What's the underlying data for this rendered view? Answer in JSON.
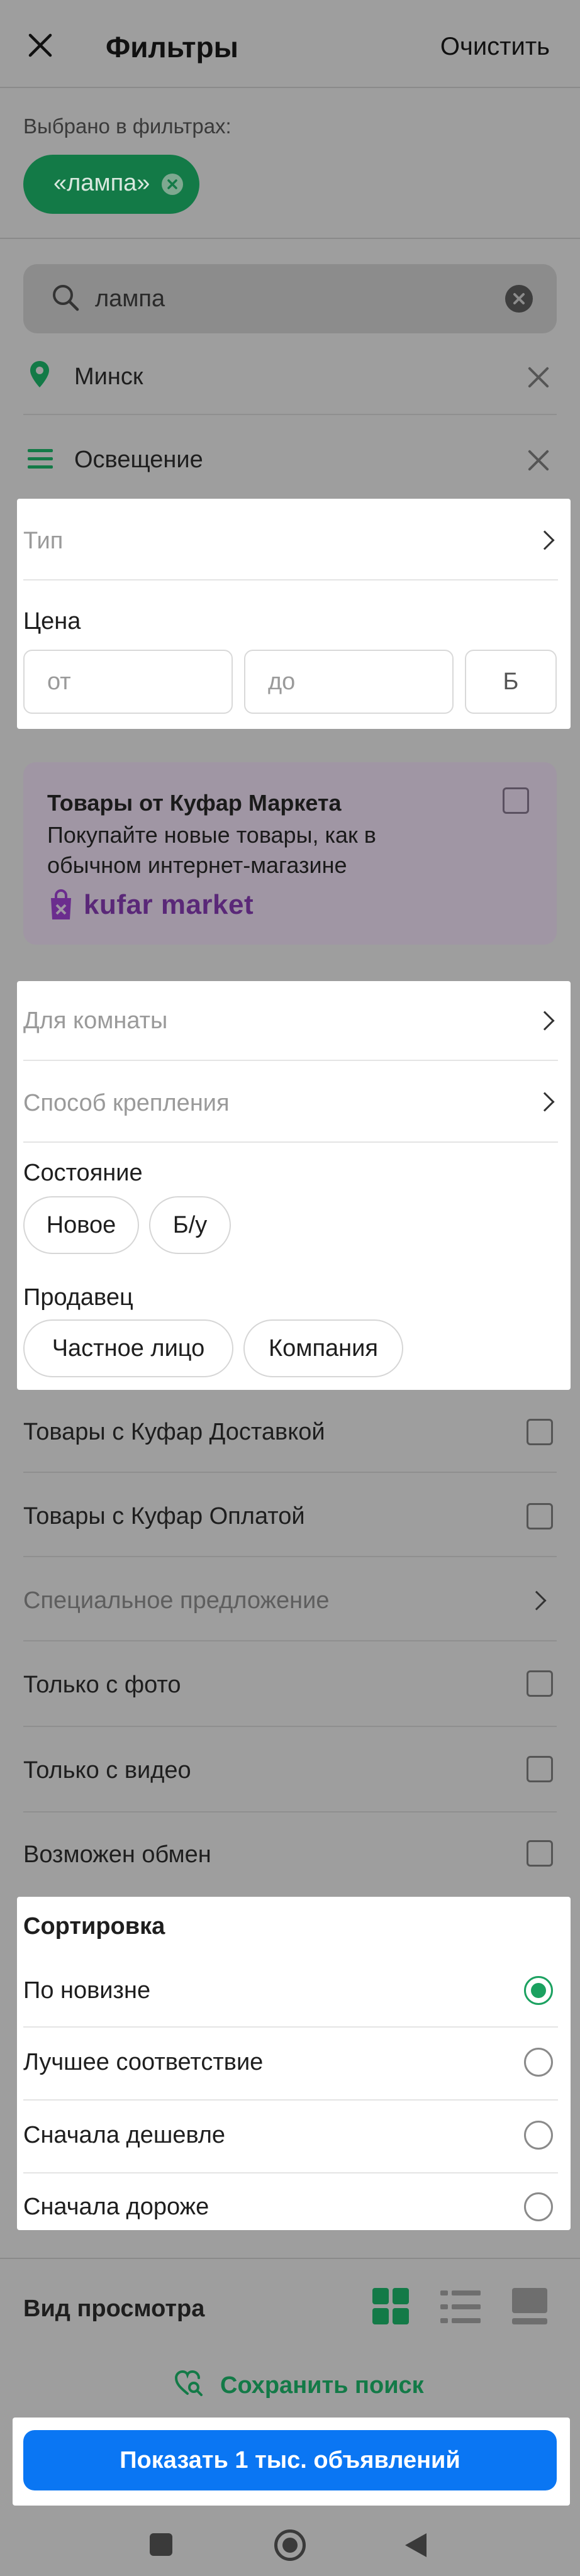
{
  "header": {
    "title": "Фильтры",
    "clear_label": "Очистить"
  },
  "selected": {
    "label": "Выбрано в фильтрах:",
    "chip": "«лампа»"
  },
  "search": {
    "value": "лампа"
  },
  "location": {
    "value": "Минск"
  },
  "category": {
    "value": "Освещение"
  },
  "type_row": {
    "label": "Тип"
  },
  "price": {
    "label": "Цена",
    "from_placeholder": "от",
    "to_placeholder": "до",
    "currency": "Б"
  },
  "kufar_market": {
    "title": "Товары от Куфар Маркета",
    "description": "Покупайте новые товары, как в обычном интернет-магазине",
    "logo_text": "kufar market"
  },
  "room_row": {
    "label": "Для комнаты"
  },
  "mount_row": {
    "label": "Способ крепления"
  },
  "condition": {
    "label": "Состояние",
    "options": [
      "Новое",
      "Б/у"
    ]
  },
  "seller": {
    "label": "Продавец",
    "options": [
      "Частное лицо",
      "Компания"
    ]
  },
  "toggles": [
    {
      "label": "Товары с Куфар Доставкой"
    },
    {
      "label": "Товары с Куфар Оплатой"
    },
    {
      "label": "Специальное предложение"
    },
    {
      "label": "Только с фото"
    },
    {
      "label": "Только с видео"
    },
    {
      "label": "Возможен обмен"
    }
  ],
  "sort": {
    "title": "Сортировка",
    "options": [
      "По новизне",
      "Лучшее соответствие",
      "Сначала дешевле",
      "Сначала дороже"
    ],
    "selected_index": 0
  },
  "view": {
    "label": "Вид просмотра"
  },
  "save_search": {
    "label": "Сохранить поиск"
  },
  "show_button": {
    "label": "Показать 1 тыс. объявлений"
  },
  "colors": {
    "accent_green": "#1ba160",
    "button_blue": "#0a76f3",
    "market_purple": "#6b2d8e"
  }
}
